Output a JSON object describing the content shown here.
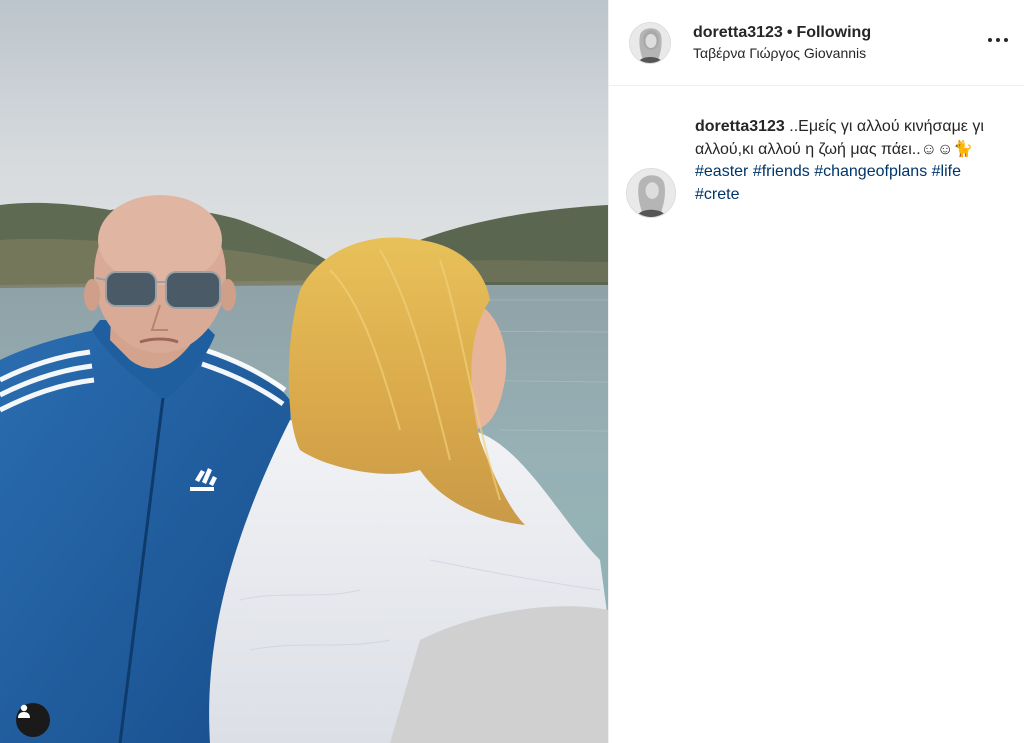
{
  "post": {
    "username": "doretta3123",
    "separator": "•",
    "follow_status": "Following",
    "location": "Ταβέρνα Γιώργος Giovannis",
    "more_label": "More options",
    "caption": {
      "username": "doretta3123",
      "text": "..Εμείς γι αλλού κινήσαμε γι αλλού,κι αλλού η ζωή μας πάει..☺☺🐈",
      "hashtags": [
        "#easter",
        "#friends",
        "#changeofplans",
        "#life",
        "#crete"
      ]
    },
    "photo": {
      "description_icon": "user-tag-icon",
      "jacket_logo": "adidas"
    }
  },
  "colors": {
    "text": "#262626",
    "hashtag": "#003569",
    "border": "#efefef",
    "jacket_blue": "#1f5d9e"
  }
}
